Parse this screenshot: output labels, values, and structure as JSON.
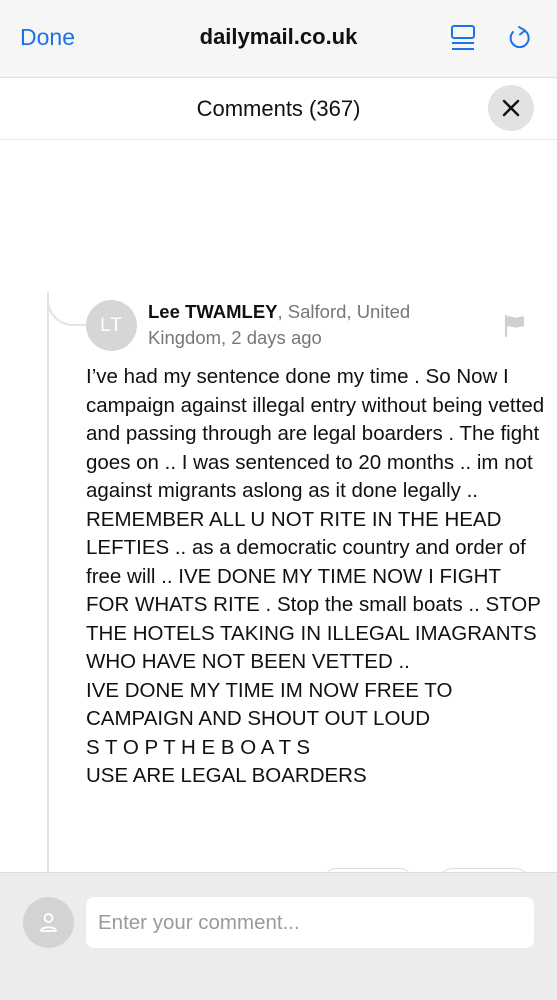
{
  "browser": {
    "done_label": "Done",
    "domain": "dailymail.co.uk",
    "accent_color": "#1a73e8"
  },
  "comments": {
    "title": "Comments (367)"
  },
  "comment": {
    "initials": "LT",
    "author": "Lee TWAMLEY",
    "location_time": ", Salford, United Kingdom, 2 days ago",
    "body": "I’ve had my sentence done my time . So Now I campaign against illegal entry without being vetted and passing through are legal boarders . The fight goes on .. I was sentenced to 20 months .. im not against migrants aslong as it done legally .. REMEMBER ALL U NOT RITE IN THE HEAD LEFTIES .. as a democratic country and order of free will .. IVE DONE MY TIME NOW I FIGHT FOR WHATS RITE . Stop the small boats .. STOP THE HOTELS TAKING IN ILLEGAL IMAGRANTS WHO HAVE NOT BEEN VETTED ..\nIVE DONE MY TIME IM NOW FREE TO CAMPAIGN AND SHOUT OUT LOUD\nS T O P T H E B O A T S\nUSE ARE LEGAL BOARDERS"
  },
  "composer": {
    "placeholder": "Enter your comment..."
  },
  "icons": {
    "reader": "reader-mode-icon",
    "reload": "reload-icon",
    "close": "close-icon",
    "flag": "flag-icon",
    "user": "user-icon"
  }
}
